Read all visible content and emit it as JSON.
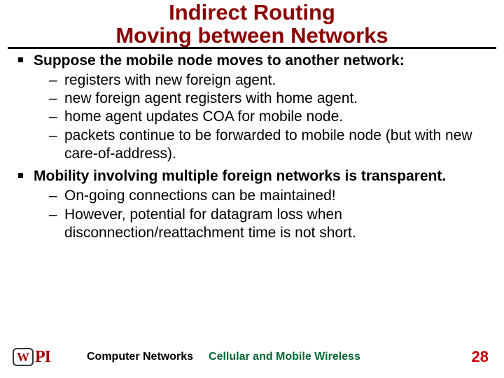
{
  "title": {
    "line1": "Indirect Routing",
    "line2": "Moving between Networks"
  },
  "points": {
    "p1": {
      "text": "Suppose the mobile node moves to another network:",
      "subs": {
        "s1": "registers with new foreign agent.",
        "s2": "new foreign agent registers with home agent.",
        "s3": "home agent updates COA for mobile node.",
        "s4": "packets continue to be forwarded to mobile node (but with new care-of-address)."
      }
    },
    "p2": {
      "text": "Mobility involving multiple foreign networks is transparent.",
      "subs": {
        "s1": "On-going connections can be maintained!",
        "s2": "However, potential for datagram loss when disconnection/reattachment time is not short."
      }
    }
  },
  "footer": {
    "course": "Computer Networks",
    "topic": "Cellular and Mobile Wireless",
    "page": "28",
    "logo_w": "W",
    "logo_pi": "PI"
  }
}
